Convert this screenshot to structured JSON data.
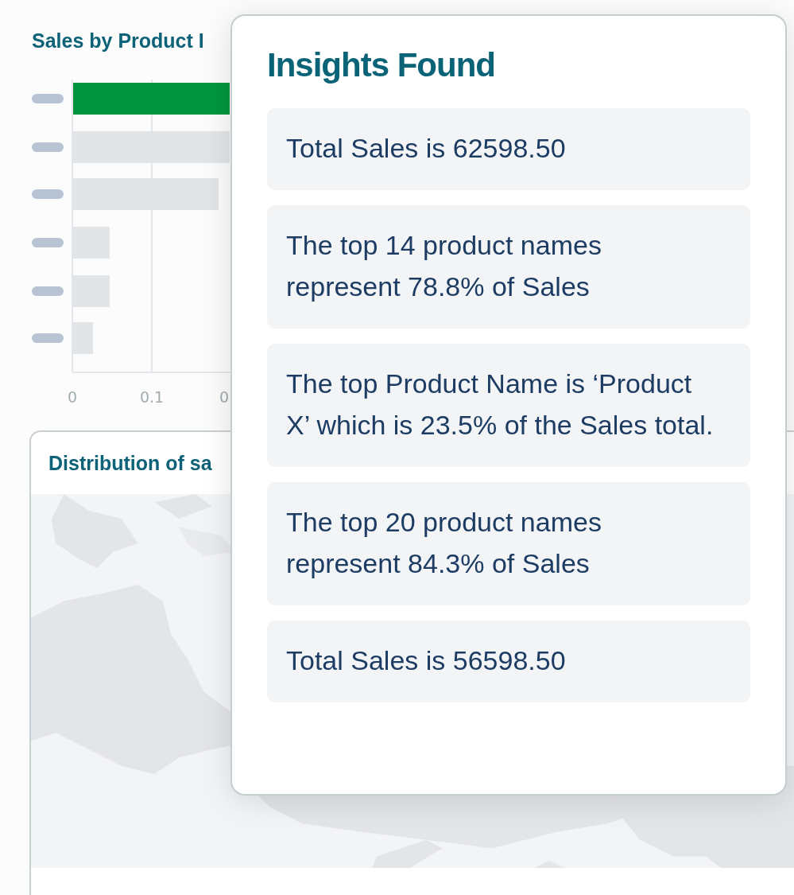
{
  "sales_chart": {
    "title": "Sales by Product I",
    "chart_data": {
      "type": "bar",
      "orientation": "horizontal",
      "categories": [
        null,
        null,
        null,
        null,
        null,
        null
      ],
      "series": [
        {
          "color": "#00963f",
          "values": [
            0.198,
            null,
            null,
            null,
            null,
            null
          ]
        },
        {
          "color": "#e2e5e7",
          "values": [
            null,
            0.198,
            0.184,
            0.047,
            0.047,
            0.026
          ]
        }
      ],
      "xlim": [
        0,
        0.21
      ],
      "xticks": [
        0,
        0.1,
        {
          "value": 0.2,
          "label": "0"
        }
      ]
    }
  },
  "map_card": {
    "title": "Distribution of sa"
  },
  "insights_popover": {
    "title": "Insights Found",
    "insights": [
      "Total Sales is 62598.50",
      "The top 14 product names represent 78.8% of Sales",
      "The top Product Name is ‘Product X’ which is 23.5% of the Sales total.",
      "The top 20 product names represent 84.3% of Sales",
      "Total Sales is 56598.50"
    ]
  }
}
